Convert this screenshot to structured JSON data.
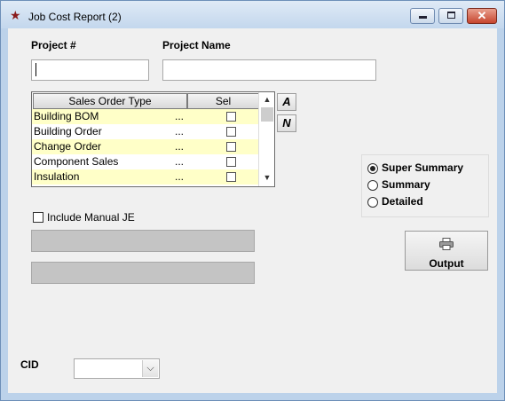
{
  "window": {
    "title": "Job Cost Report (2)",
    "icon": "app-star-icon",
    "controls": {
      "minimize": "minimize-icon",
      "maximize": "maximize-icon",
      "close": "✕"
    }
  },
  "project": {
    "number_label": "Project #",
    "number_value": "",
    "name_label": "Project Name",
    "name_value": ""
  },
  "sales_order_grid": {
    "columns": [
      "Sales Order Type",
      "Sel"
    ],
    "rows": [
      {
        "type": "Building BOM",
        "dots": "...",
        "selected": false
      },
      {
        "type": "Building Order",
        "dots": "...",
        "selected": false
      },
      {
        "type": "Change Order",
        "dots": "...",
        "selected": false
      },
      {
        "type": "Component Sales",
        "dots": "...",
        "selected": false
      },
      {
        "type": "Insulation",
        "dots": "...",
        "selected": false
      }
    ],
    "scroll_up": "▲",
    "scroll_down": "▼"
  },
  "side_buttons": {
    "all": "A",
    "none": "N"
  },
  "include_manual_je": {
    "label": "Include Manual JE",
    "checked": false
  },
  "report_level": {
    "options": [
      "Super Summary",
      "Summary",
      "Detailed"
    ],
    "selected": "Super Summary"
  },
  "output_button": {
    "label": "Output",
    "icon": "printer-icon"
  },
  "cid": {
    "label": "CID",
    "value": "",
    "dropdown_icon": "chevron-down-icon"
  },
  "colors": {
    "grid_row_highlight": "#ffffc8",
    "titlebar": "#c3d7ed",
    "close_button": "#c6452e"
  }
}
